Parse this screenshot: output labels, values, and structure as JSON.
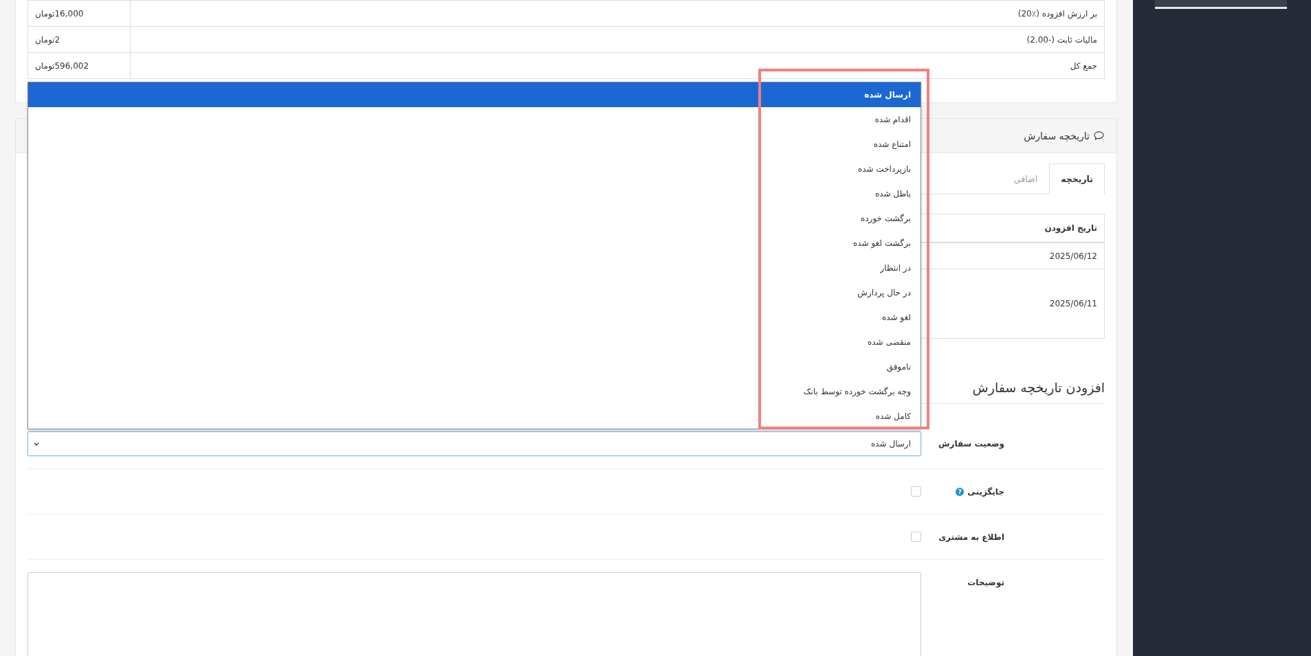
{
  "totals": [
    {
      "label": "بر ارزش افزوده (٪20)",
      "amount": "16,000تومان"
    },
    {
      "label": "مالیات ثابت (-2.00)",
      "amount": "2تومان"
    },
    {
      "label": "جمع کل",
      "amount": "596,002تومان"
    }
  ],
  "history": {
    "title": "تاریخچه سفارش",
    "tabs": [
      {
        "label": "تاریخچه",
        "selected": true
      },
      {
        "label": "اضافی",
        "selected": false
      }
    ],
    "table": {
      "columns": [
        "تاریخ افزودن"
      ],
      "rows": [
        [
          "2025/06/12"
        ],
        [
          "2025/06/11"
        ]
      ]
    }
  },
  "add_history": {
    "title": "افزودن تاریخچه سفارش",
    "order_status": {
      "label": "وضعیت سفارش",
      "value": "ارسال شده",
      "expanded": true,
      "options": [
        {
          "label": "ارسال شده",
          "selected": true
        },
        {
          "label": "اقدام شده",
          "selected": false
        },
        {
          "label": "امتناع شده",
          "selected": false
        },
        {
          "label": "بازپرداخت شده",
          "selected": false
        },
        {
          "label": "باطل شده",
          "selected": false
        },
        {
          "label": "برگشت خورده",
          "selected": false
        },
        {
          "label": "برگشت لغو شده",
          "selected": false
        },
        {
          "label": "در انتظار",
          "selected": false
        },
        {
          "label": "در حال پردازش",
          "selected": false
        },
        {
          "label": "لغو شده",
          "selected": false
        },
        {
          "label": "منقضی شده",
          "selected": false
        },
        {
          "label": "ناموفق",
          "selected": false
        },
        {
          "label": "وجه برگشت خورده توسط بانک",
          "selected": false
        },
        {
          "label": "کامل شده",
          "selected": false
        }
      ]
    },
    "override": {
      "label": "جایگزینی",
      "help": "?",
      "checked": false
    },
    "notify": {
      "label": "اطلاع به مشتری",
      "checked": false
    },
    "comment": {
      "label": "توضیحات"
    }
  }
}
